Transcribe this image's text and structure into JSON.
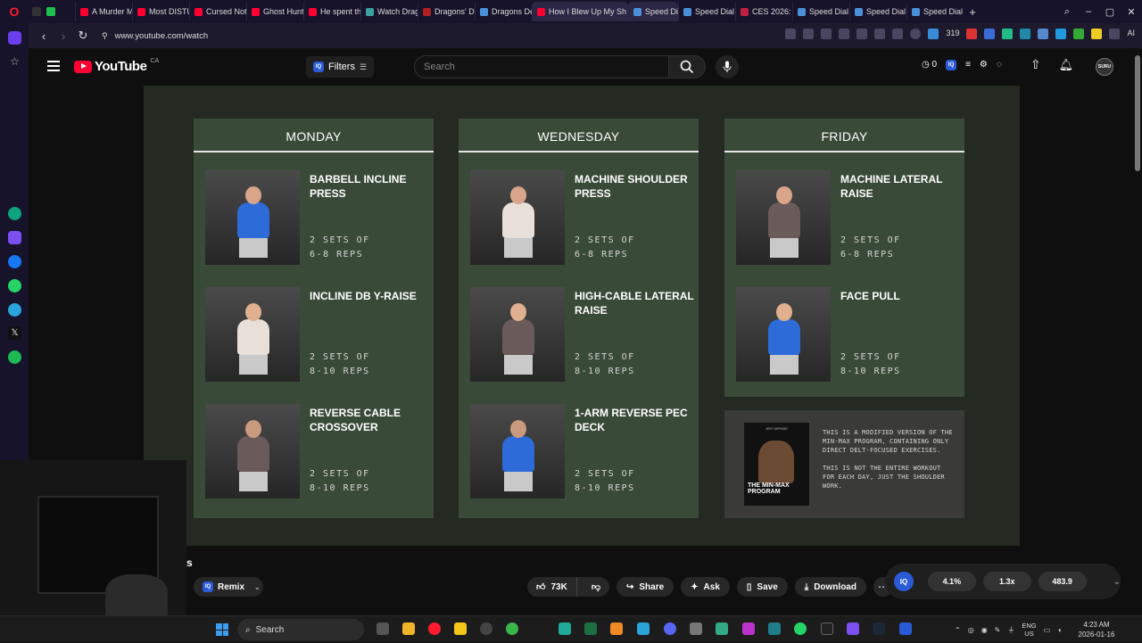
{
  "browser": {
    "tabs": [
      {
        "label": "A Murder My",
        "color": "#ff0033"
      },
      {
        "label": "Most DISTUR",
        "color": "#ff0033"
      },
      {
        "label": "Cursed Note",
        "color": "#ff0033"
      },
      {
        "label": "Ghost Huntin",
        "color": "#ff0033"
      },
      {
        "label": "He spent the",
        "color": "#ff0033"
      },
      {
        "label": "Watch Drago",
        "color": "#3aa0a0"
      },
      {
        "label": "Dragons' De",
        "color": "#b02020"
      },
      {
        "label": "Dragons Den",
        "color": "#4a90d9"
      },
      {
        "label": "How I Blew Up My Sh",
        "color": "#ff0033"
      },
      {
        "label": "Speed Di",
        "color": "#4a90d9"
      },
      {
        "label": "Speed Dial",
        "color": "#4a90d9"
      },
      {
        "label": "CES 2026: 20",
        "color": "#c02040"
      },
      {
        "label": "Speed Dial",
        "color": "#4a90d9"
      },
      {
        "label": "Speed Dial",
        "color": "#4a90d9"
      },
      {
        "label": "Speed Dial",
        "color": "#4a90d9"
      }
    ],
    "url": "www.youtube.com/watch",
    "badge_count": "319",
    "ai_label": "AI"
  },
  "youtube": {
    "logo_text": "YouTube",
    "country": "CA",
    "filters_label": "Filters",
    "iq_label": "IQ",
    "search_placeholder": "Search",
    "header_count": "0",
    "avatar_text": "SURU"
  },
  "video": {
    "days": [
      {
        "name": "MONDAY",
        "exercises": [
          {
            "name": "BARBELL INCLINE PRESS",
            "sets": "2 SETS OF\n6-8 REPS"
          },
          {
            "name": "INCLINE DB Y-RAISE",
            "sets": "2 SETS OF\n8-10 REPS"
          },
          {
            "name": "REVERSE CABLE CROSSOVER",
            "sets": "2 SETS OF\n8-10 REPS"
          }
        ]
      },
      {
        "name": "WEDNESDAY",
        "exercises": [
          {
            "name": "MACHINE SHOULDER PRESS",
            "sets": "2 SETS OF\n6-8 REPS"
          },
          {
            "name": "HIGH-CABLE LATERAL RAISE",
            "sets": "2 SETS OF\n8-10 REPS"
          },
          {
            "name": "1-ARM REVERSE PEC DECK",
            "sets": "2 SETS OF\n8-10 REPS"
          }
        ]
      },
      {
        "name": "FRIDAY",
        "exercises": [
          {
            "name": "MACHINE LATERAL RAISE",
            "sets": "2 SETS OF\n6-8 REPS"
          },
          {
            "name": "FACE PULL",
            "sets": "2 SETS OF\n8-10 REPS"
          }
        ]
      }
    ],
    "note": {
      "book_author": "JEFF NIPPARD",
      "book_title": "THE MIN-MAX PROGRAM",
      "text_1": "THIS IS A MODIFIED VERSION OF THE MIN-MAX PROGRAM, CONTAINING ONLY DIRECT DELT-FOCUSED EXERCISES.",
      "text_2": "THIS IS NOT THE ENTIRE WORKOUT FOR EACH DAY, JUST THE SHOULDER WORK."
    }
  },
  "actions": {
    "channel_fragment": "s",
    "remix_label": "Remix",
    "like_count": "73K",
    "share_label": "Share",
    "ask_label": "Ask",
    "save_label": "Save",
    "download_label": "Download"
  },
  "stats": {
    "iq_label": "IQ",
    "values": [
      "4.1%",
      "1.3x",
      "483.9"
    ]
  },
  "taskbar": {
    "search_label": "Search",
    "lang_top": "ENG",
    "lang_bottom": "US",
    "time": "4:23 AM",
    "date": "2026-01-16"
  }
}
